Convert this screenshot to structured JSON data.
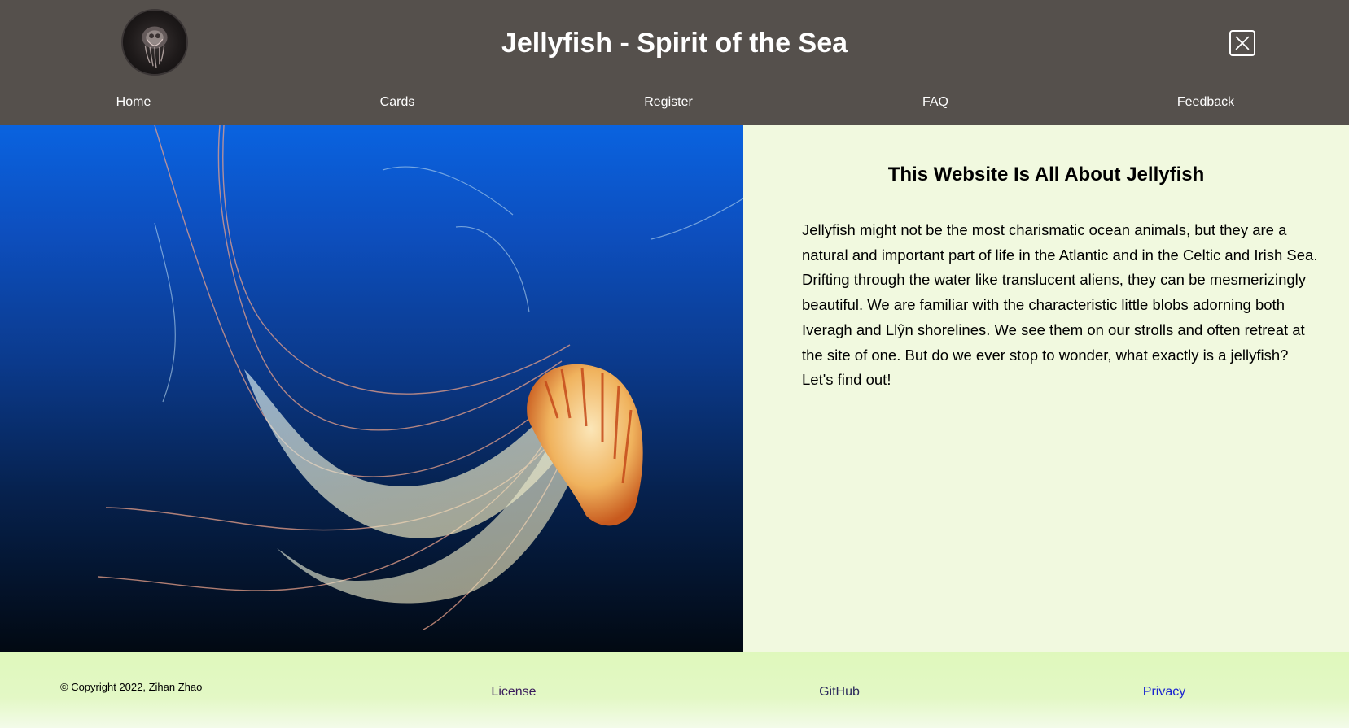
{
  "header": {
    "title": "Jellyfish - Spirit of the Sea",
    "logo_icon": "jellyfish-logo",
    "close_icon": "close-icon"
  },
  "nav": {
    "items": [
      {
        "label": "Home"
      },
      {
        "label": "Cards"
      },
      {
        "label": "Register"
      },
      {
        "label": "FAQ"
      },
      {
        "label": "Feedback"
      }
    ]
  },
  "main": {
    "hero_image": "jellyfish-photo",
    "heading": "This Website Is All About Jellyfish",
    "paragraph": "Jellyfish might not be the most charismatic ocean animals, but they are a natural and important part of life in the Atlantic and in the Celtic and Irish Sea. Drifting through the water like translucent aliens, they can be mesmerizingly beautiful. We are familiar with the characteristic little blobs adorning both Iveragh and Llŷn shorelines. We see them on our strolls and often retreat at the site of one. But do we ever stop to wonder, what exactly is a jellyfish? Let's find out!"
  },
  "footer": {
    "copyright": "© Copyright 2022, Zihan Zhao",
    "links": [
      {
        "label": "License",
        "color": "#3a1d5c"
      },
      {
        "label": "GitHub",
        "color": "#2b2a5c"
      },
      {
        "label": "Privacy",
        "color": "#1a24d0"
      }
    ]
  },
  "colors": {
    "header_bg": "#55504c",
    "intro_bg": "#f1f9df",
    "footer_bg": "#dff8bc"
  }
}
